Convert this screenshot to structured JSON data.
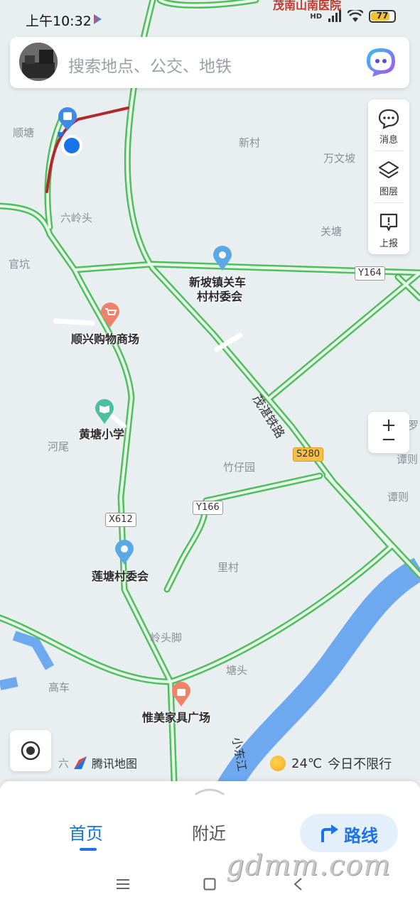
{
  "status_bar": {
    "time": "上午10:32",
    "network": "HD",
    "battery": "77",
    "battery_fraction": 0.77
  },
  "search": {
    "placeholder": "搜索地点、公交、地铁"
  },
  "side_panel": {
    "items": [
      {
        "label": "消息",
        "icon": "message-icon"
      },
      {
        "label": "图层",
        "icon": "layers-icon"
      },
      {
        "label": "上报",
        "icon": "report-icon"
      }
    ]
  },
  "zoom": {
    "in": "+",
    "out": "−"
  },
  "map": {
    "places": [
      "顺塘",
      "新村",
      "万文坡",
      "六岭头",
      "关塘",
      "官坑",
      "河尾",
      "竹仔园",
      "谭则",
      "谭则",
      "里村",
      "岭头脚",
      "塘头",
      "高车",
      "罗"
    ],
    "pois": [
      "新坡镇关车",
      "村村委会",
      "顺兴购物商场",
      "黄塘小学",
      "莲塘村委会",
      "惟美家具广场"
    ],
    "top_label": "茂南山南医院",
    "roads": [
      "Y164",
      "S280",
      "Y166",
      "X612"
    ],
    "railway": "茂湛铁路",
    "river": "小东江",
    "corner_fragment": "六"
  },
  "brand": {
    "name": "腾讯地图"
  },
  "weather": {
    "temp": "24℃",
    "restriction": "今日不限行"
  },
  "bottom_tabs": {
    "home": "首页",
    "nearby": "附近",
    "route": "路线"
  },
  "watermark": "gdmm.com",
  "colors": {
    "road": "#5fd36e",
    "traffic_red": "#b3282d",
    "accent": "#1a73e8",
    "river": "#6ea8ef",
    "map_bg": "#e9eef0"
  }
}
